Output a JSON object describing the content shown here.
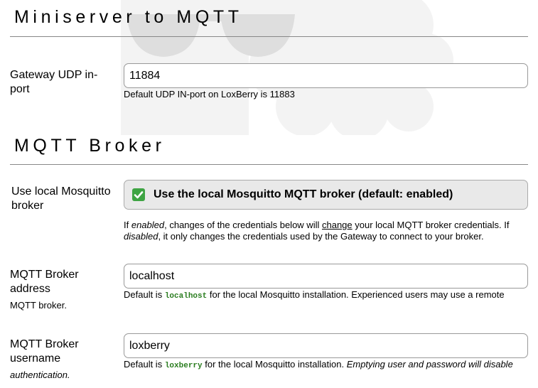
{
  "sections": {
    "miniserver_title": "Miniserver to MQTT",
    "broker_title": "MQTT Broker"
  },
  "udp": {
    "label": "Gateway UDP in-port",
    "value": "11884",
    "help": "Default UDP IN-port on LoxBerry is 11883"
  },
  "local_mosquitto": {
    "label": "Use local Mosquitto broker",
    "checked": true,
    "checkbox_label": "Use the local Mosquitto MQTT broker (default: enabled)",
    "help_parts": {
      "p1": "If ",
      "enabled": "enabled",
      "p2": ", changes of the credentials below will ",
      "change": "change",
      "p3": " your local MQTT broker credentials. If ",
      "disabled": "disabled",
      "p4": ", it only changes the credentials used by the Gateway to connect to your broker."
    }
  },
  "broker_address": {
    "label": "MQTT Broker address",
    "sublabel": "MQTT broker.",
    "value": "localhost",
    "help_prefix": "Default is ",
    "help_code": "localhost",
    "help_suffix": " for the local Mosquitto installation. Experienced users may use a remote"
  },
  "broker_username": {
    "label": "MQTT Broker username",
    "sublabel": "authentication.",
    "value": "loxberry",
    "help_prefix": "Default is ",
    "help_code": "loxberry",
    "help_middle": " for the local Mosquitto installation. ",
    "help_italic": "Emptying user and password will disable"
  },
  "icons": {
    "watermark": "loxberry-logo-watermark-icon",
    "checkbox": "checkmark-icon"
  },
  "colors": {
    "checkbox_green": "#3ea443",
    "code_green": "#2a7d1f"
  }
}
